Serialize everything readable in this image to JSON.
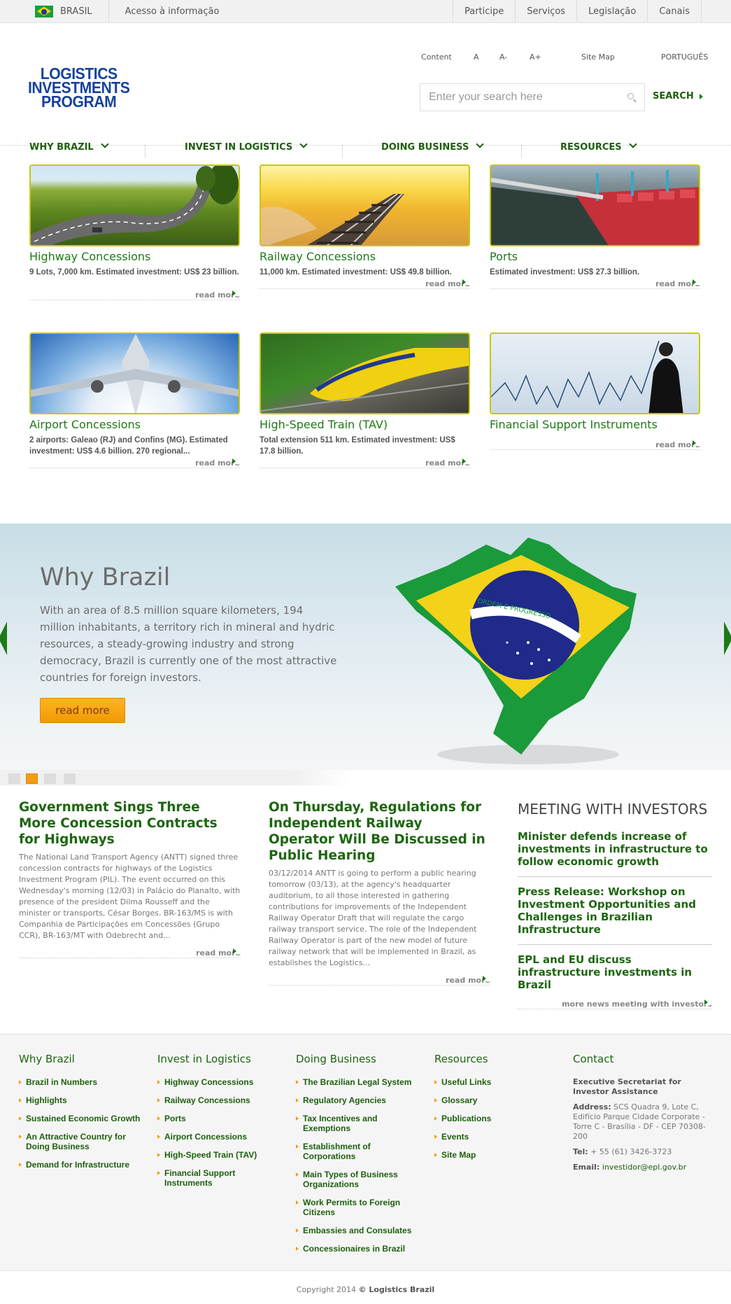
{
  "gov_bar": {
    "brasil": "BRASIL",
    "info": "Acesso à informação",
    "links": [
      "Participe",
      "Serviços",
      "Legislação",
      "Canais"
    ]
  },
  "header": {
    "logo_lines": [
      "LOGISTICS",
      "INVESTMENTS",
      "PROGRAM"
    ],
    "utility": {
      "content": "Content",
      "font_normal": "A",
      "font_smaller": "A-",
      "font_larger": "A+",
      "site_map": "Site Map",
      "language": "PORTUGUÊS"
    },
    "search": {
      "placeholder": "Enter your search here",
      "button": "SEARCH"
    }
  },
  "nav": [
    "WHY BRAZIL",
    "INVEST IN LOGISTICS",
    "DOING BUSINESS",
    "RESOURCES"
  ],
  "tiles": [
    {
      "title": "Highway Concessions",
      "desc": "9 Lots, 7,000 km. Estimated investment: US$ 23 billion.",
      "more": "read more"
    },
    {
      "title": "Railway Concessions",
      "desc": "11,000 km. Estimated investment: US$ 49.8 billion.",
      "more": "read more"
    },
    {
      "title": "Ports",
      "desc": "Estimated investment: US$ 27.3 billion.",
      "more": "read more"
    },
    {
      "title": "Airport Concessions",
      "desc": "2 airports: Galeao (RJ) and Confins (MG). Estimated investment: US$ 4.6 billion. 270 regional...",
      "more": "read more"
    },
    {
      "title": "High-Speed Train (TAV)",
      "desc": "Total extension 511 km. Estimated investment: US$ 17.8 billion.",
      "more": "read more"
    },
    {
      "title": "Financial Support Instruments",
      "desc": "",
      "more": "read more"
    }
  ],
  "banner": {
    "title": "Why Brazil",
    "text": "With an area of 8.5 million square kilometers, 194 million inhabitants, a territory rich in mineral and hydric resources, a steady-growing industry and strong democracy, Brazil is currently one of the most attractive countries for foreign investors.",
    "button": "read more",
    "flag_motto": "ORDEM E PROGRESSO"
  },
  "news": [
    {
      "title": "Government Sings Three More Concession Contracts for Highways",
      "text": "The National Land Transport Agency (ANTT) signed three concession contracts for highways of the Logistics Investment Program (PIL). The event occurred on this Wednesday's morning (12/03) in Palácio do Planalto, with presence of the president Dilma Rousseff and the minister or transports, César Borges. BR-163/MS is with Companhia de Participações em Concessões (Grupo CCR), BR-163/MT with Odebrecht and...",
      "more": "read more"
    },
    {
      "title": "On Thursday, Regulations for Independent Railway Operator Will Be Discussed in Public Hearing",
      "text": "03/12/2014 ANTT is going to perform a public hearing tomorrow (03/13), at the agency's headquarter auditorium, to all those interested in gathering contributions for improvements of the Independent Railway Operator Draft that will regulate the cargo railway transport service. The role of the Independent Railway Operator is part of the new model of future railway network that will be implemented in Brazil, as establishes the Logistics...",
      "more": "read more"
    }
  ],
  "meeting": {
    "title": "MEETING WITH INVESTORS",
    "items": [
      "Minister defends increase of investments in infrastructure to follow economic growth",
      "Press Release: Workshop on Investment Opportunities and Challenges in Brazilian Infrastructure",
      "EPL and EU discuss infrastructure investments in Brazil"
    ],
    "more": "more news meeting with investors"
  },
  "footer": {
    "columns": [
      {
        "title": "Why Brazil",
        "items": [
          "Brazil in Numbers",
          "Highlights",
          "Sustained Economic Growth",
          "An Attractive Country for Doing Business",
          "Demand for Infrastructure"
        ]
      },
      {
        "title": "Invest in Logistics",
        "items": [
          "Highway Concessions",
          "Railway Concessions",
          "Ports",
          "Airport Concessions",
          "High-Speed Train (TAV)",
          "Financial Support Instruments"
        ]
      },
      {
        "title": "Doing Business",
        "items": [
          "The Brazilian Legal System",
          "Regulatory Agencies",
          "Tax Incentives and Exemptions",
          "Establishment of Corporations",
          "Main Types of Business Organizations",
          "Work Permits to Foreign Citizens",
          "Embassies and Consulates",
          "Concessionaires in Brazil"
        ]
      },
      {
        "title": "Resources",
        "items": [
          "Useful Links",
          "Glossary",
          "Publications",
          "Events",
          "Site Map"
        ]
      }
    ],
    "contact": {
      "title": "Contact",
      "org": "Executive Secretariat for Investor Assistance",
      "address_label": "Address:",
      "address": "SCS Quadra 9, Lote C, Edifício Parque Cidade Corporate - Torre C - Brasília - DF - CEP 70308-200",
      "tel_label": "Tel:",
      "tel": "+ 55 (61) 3426-3723",
      "email_label": "Email:",
      "email": "investidor@epl.gov.br"
    },
    "copyright_prefix": "Copyright 2014",
    "copyright_brand": "© Logistics Brazil"
  },
  "colors": {
    "primary_green": "#1d6610",
    "accent_orange": "#f39c12",
    "logo_blue": "#16439a",
    "tile_border": "#c8c70f"
  }
}
